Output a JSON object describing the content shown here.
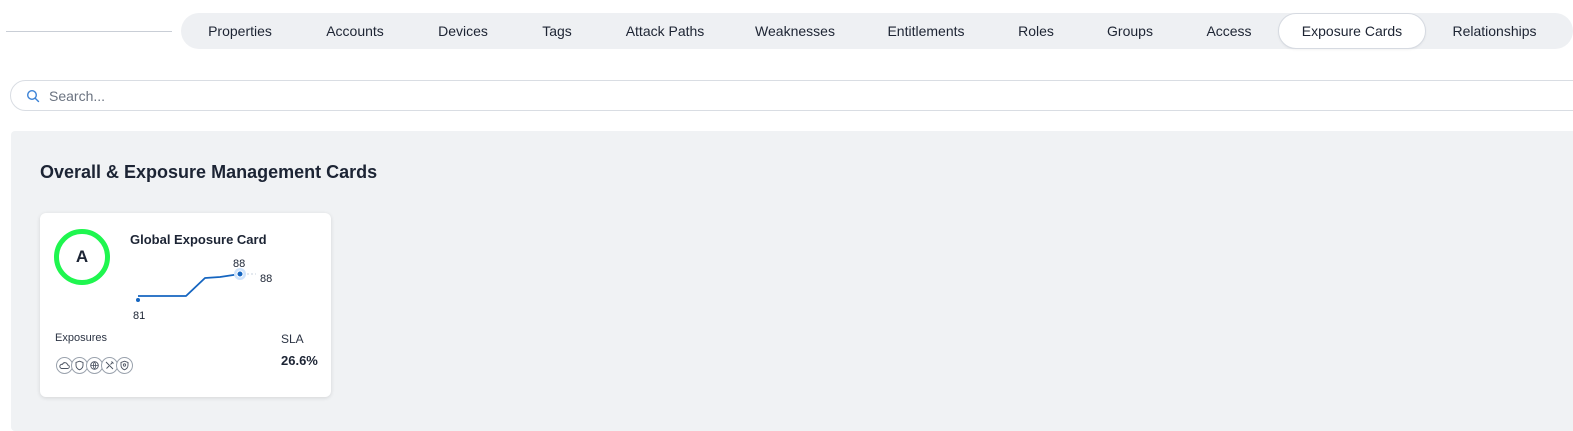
{
  "tabs": [
    {
      "label": "Properties"
    },
    {
      "label": "Accounts"
    },
    {
      "label": "Devices"
    },
    {
      "label": "Tags"
    },
    {
      "label": "Attack Paths"
    },
    {
      "label": "Weaknesses"
    },
    {
      "label": "Entitlements"
    },
    {
      "label": "Roles"
    },
    {
      "label": "Groups"
    },
    {
      "label": "Access"
    },
    {
      "label": "Exposure Cards",
      "active": true
    },
    {
      "label": "Relationships"
    }
  ],
  "search": {
    "placeholder": "Search..."
  },
  "section": {
    "title": "Overall & Exposure Management Cards"
  },
  "card": {
    "grade": "A",
    "title": "Global Exposure Card",
    "trend": {
      "values": [
        81,
        81,
        81,
        81,
        88,
        88,
        88
      ],
      "start_label": "81",
      "current_label": "88",
      "end_label": "88"
    },
    "exposures_label": "Exposures",
    "exposure_icons": [
      "cloud-icon",
      "shield-icon",
      "globe-icon",
      "tools-icon",
      "badge-icon"
    ],
    "sla_label": "SLA",
    "sla_value": "26.6%"
  },
  "colors": {
    "grade_ring": "#1ff64f",
    "trend_line": "#1565c0",
    "accent": "#3b82d6"
  }
}
